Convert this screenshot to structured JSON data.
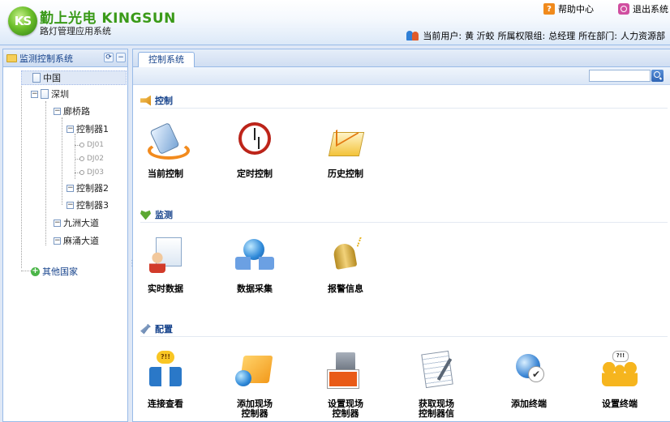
{
  "header": {
    "logo_text": "KS",
    "brand": "勤上光电 KINGSUN",
    "subtitle": "路灯管理应用系统",
    "help_label": "帮助中心",
    "exit_label": "退出系统",
    "current_user_label": "当前用户:",
    "current_user": "黄 沂蛟",
    "group_label": "所属权限组:",
    "group": "总经理",
    "dept_label": "所在部门:",
    "dept": "人力资源部"
  },
  "sidebar": {
    "title": "监测控制系统",
    "tree": {
      "root": "中国",
      "shenzhen": "深圳",
      "road1": "廊桥路",
      "ctrl1": "控制器1",
      "dj1": "DJ01",
      "dj2": "DJ02",
      "dj3": "DJ03",
      "ctrl2": "控制器2",
      "ctrl3": "控制器3",
      "road2": "九洲大道",
      "road3": "麻涌大道",
      "other": "其他国家"
    }
  },
  "main": {
    "tab_label": "控制系统",
    "search_placeholder": "",
    "sections": {
      "control": {
        "title": "控制",
        "items": [
          "当前控制",
          "定时控制",
          "历史控制"
        ]
      },
      "monitor": {
        "title": "监测",
        "items": [
          "实时数据",
          "数据采集",
          "报警信息"
        ]
      },
      "config": {
        "title": "配置",
        "items": [
          "连接查看",
          "添加现场\n控制器",
          "设置现场\n控制器",
          "获取现场\n控制器信",
          "添加终端",
          "设置终端"
        ]
      }
    }
  }
}
